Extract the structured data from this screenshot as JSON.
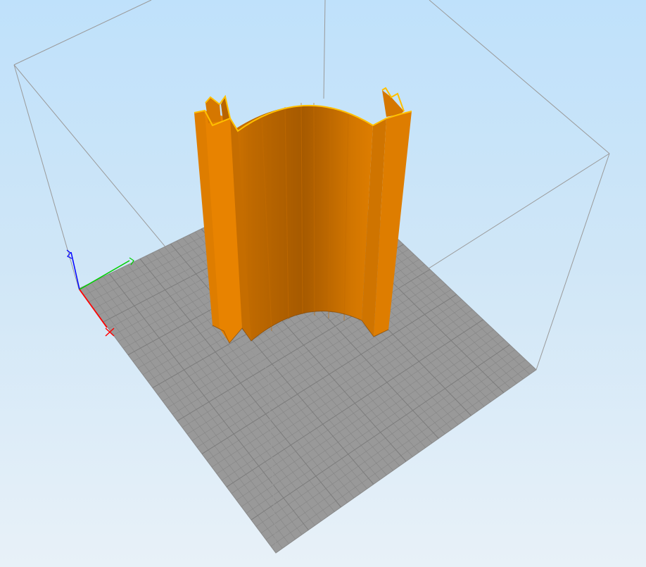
{
  "viewer": {
    "axis_labels": {
      "x": "X",
      "y": "Y",
      "z": "Z"
    },
    "colors": {
      "background_top": "#bfe1fb",
      "background_bottom": "#e8f1f8",
      "bed": "#999999",
      "grid_line": "#868686",
      "build_volume_edge": "#9a9a9a",
      "model_base": "#d97800",
      "model_dark": "#a85a00",
      "model_edge": "#ffc000",
      "axis_x": "#ff0000",
      "axis_y": "#00d000",
      "axis_z": "#0000ff"
    }
  }
}
